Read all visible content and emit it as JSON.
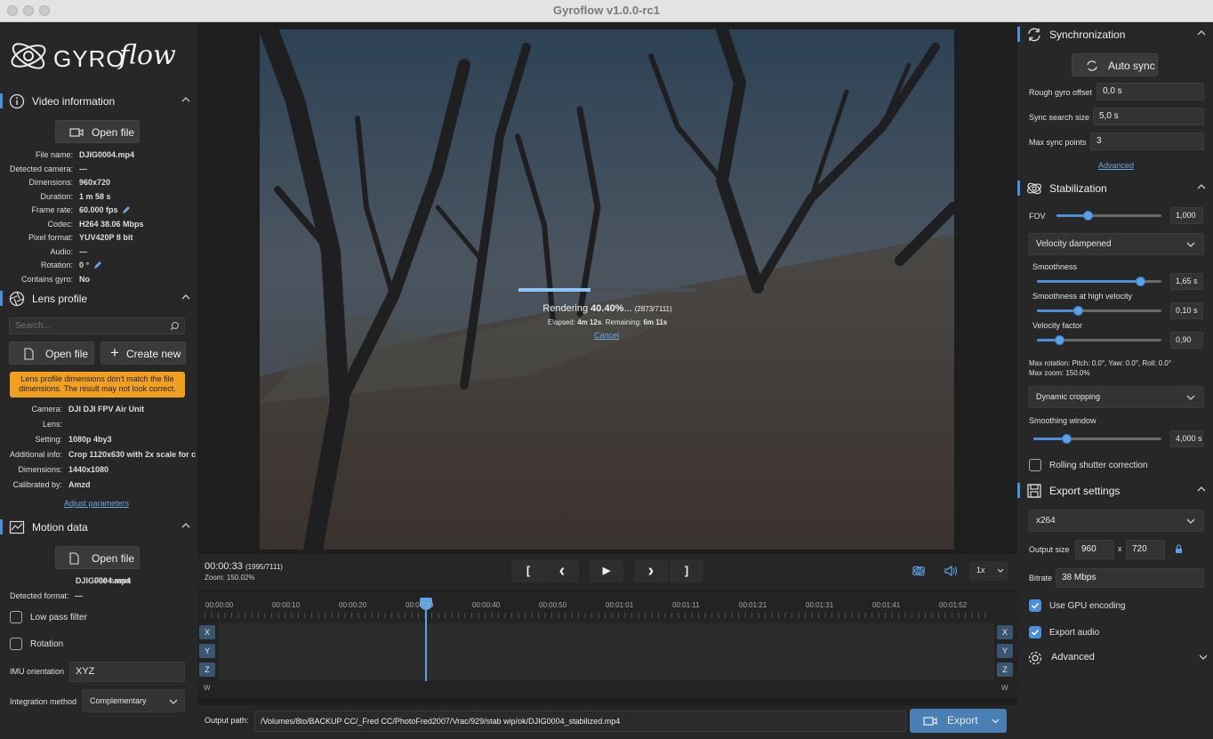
{
  "window": {
    "title": "Gyroflow v1.0.0-rc1"
  },
  "brand": {
    "logo_text": "GYRO",
    "logo_script": "flow"
  },
  "video_info": {
    "title": "Video information",
    "open_file": "Open file",
    "rows": [
      {
        "k": "File name:",
        "v": "DJIG0004.mp4"
      },
      {
        "k": "Detected camera:",
        "v": "---"
      },
      {
        "k": "Dimensions:",
        "v": "960x720"
      },
      {
        "k": "Duration:",
        "v": "1 m 58 s"
      },
      {
        "k": "Frame rate:",
        "v": "60.000 fps"
      },
      {
        "k": "Codec:",
        "v": "H264 38.06 Mbps"
      },
      {
        "k": "Pixel format:",
        "v": "YUV420P 8 bit"
      },
      {
        "k": "Audio:",
        "v": "---"
      },
      {
        "k": "Rotation:",
        "v": "0 °"
      },
      {
        "k": "Contains gyro:",
        "v": "No"
      }
    ]
  },
  "lens": {
    "title": "Lens profile",
    "search_placeholder": "Search...",
    "open_file": "Open file",
    "create_new": "Create new",
    "warning": "Lens profile dimensions don't match the file dimensions. The result may not look correct.",
    "rows": [
      {
        "k": "Camera:",
        "v": "DJI  DJI FPV Air Unit"
      },
      {
        "k": "Lens:",
        "v": ""
      },
      {
        "k": "Setting:",
        "v": "1080p 4by3"
      },
      {
        "k": "Additional info:",
        "v": "Crop 1120x630 with 2x scale for c"
      },
      {
        "k": "Dimensions:",
        "v": "1440x1080"
      },
      {
        "k": "Calibrated by:",
        "v": "Amzd"
      }
    ],
    "adjust": "Adjust parameters"
  },
  "motion": {
    "title": "Motion data",
    "open_file": "Open file",
    "file_label": "File name:",
    "file_value": "DJIG0004.mp4",
    "format_label": "Detected format:",
    "format_value": "---",
    "low_pass": "Low pass filter",
    "rotation": "Rotation",
    "imu_label": "IMU orientation",
    "imu_value": "XYZ",
    "integration_label": "Integration method",
    "integration_value": "Complementary"
  },
  "render": {
    "progress": 0.404,
    "rendering_label": "Rendering",
    "percent": "40.40%",
    "ellipsis": "...",
    "frames": "(2873/7111)",
    "elapsed_label": "Elapsed:",
    "elapsed": "4m 12s",
    "remaining_label": ". Remaining:",
    "remaining": "6m 11s",
    "cancel": "Cancel"
  },
  "playback": {
    "time": "00:00:33",
    "frame": "(1995/7111)",
    "zoom": "Zoom: 150.02%",
    "speed": "1x",
    "btn_in": "[",
    "btn_prev": "‹",
    "btn_play": "▶",
    "btn_next": "›",
    "btn_out": "]"
  },
  "timeline": {
    "ticks": [
      "00:00:00",
      "00:00:10",
      "00:00:20",
      "00:00:30",
      "00:00:40",
      "00:00:50",
      "00:01:01",
      "00:01:11",
      "00:01:21",
      "00:01:31",
      "00:01:41",
      "00:01:52"
    ],
    "playhead_fraction": 0.28,
    "axes": [
      "X",
      "Y",
      "Z",
      "W"
    ]
  },
  "output": {
    "label": "Output path:",
    "path": "/Volumes/8to/BACKUP CC/_Fred CC/PhotoFred2007/Vrac/929/stab wip/ok/DJIG0004_stabilized.mp4",
    "export": "Export"
  },
  "sync": {
    "title": "Synchronization",
    "auto_sync": "Auto sync",
    "rough_label": "Rough gyro offset",
    "rough_value": "0,0 s",
    "search_label": "Sync search size",
    "search_value": "5,0 s",
    "points_label": "Max sync points",
    "points_value": "3",
    "advanced": "Advanced"
  },
  "stab": {
    "title": "Stabilization",
    "fov_label": "FOV",
    "fov_value": "1,000",
    "fov_level": 0.3,
    "method": "Velocity dampened",
    "smooth_label": "Smoothness",
    "smooth_value": "1,65 s",
    "smooth_level": 0.83,
    "high_label": "Smoothness at high velocity",
    "high_value": "0,10 s",
    "high_level": 0.33,
    "factor_label": "Velocity factor",
    "factor_value": "0,90",
    "factor_level": 0.18,
    "max_rot": "Max rotation: Pitch: 0.0°, Yaw: 0.0°, Roll: 0.0°",
    "max_zoom": "Max zoom: 150.0%",
    "cropping": "Dynamic cropping",
    "window_label": "Smoothing window",
    "window_value": "4,000 s",
    "window_level": 0.26,
    "rolling": "Rolling shutter correction"
  },
  "export_settings": {
    "title": "Export settings",
    "codec": "x264",
    "size_label": "Output size",
    "width": "960",
    "x": "x",
    "height": "720",
    "bitrate_label": "Bitrate",
    "bitrate": "38 Mbps",
    "gpu": "Use GPU encoding",
    "audio": "Export audio",
    "advanced": "Advanced"
  },
  "colors": {
    "accent": "#4a90d9",
    "warning": "#f0a01e",
    "panel": "#272727"
  }
}
